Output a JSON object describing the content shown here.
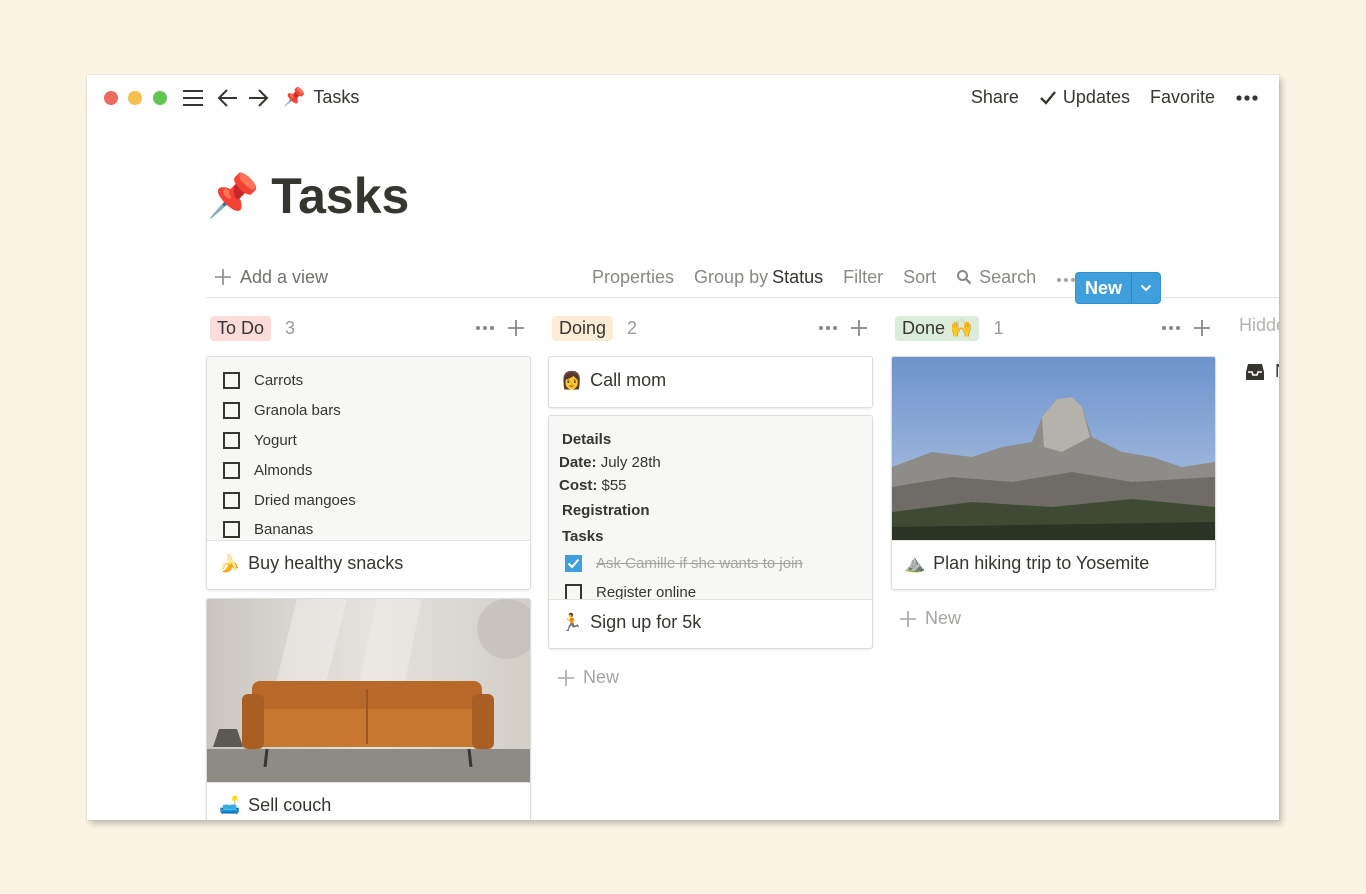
{
  "window": {
    "breadcrumb": {
      "emoji": "📌",
      "title": "Tasks"
    },
    "actions": {
      "share": "Share",
      "updates": "Updates",
      "favorite": "Favorite"
    }
  },
  "page": {
    "emoji": "📌",
    "title": "Tasks"
  },
  "viewbar": {
    "add_view": "Add a view",
    "properties": "Properties",
    "group_by_prefix": "Group by",
    "group_by_value": "Status",
    "filter": "Filter",
    "sort": "Sort",
    "search": "Search",
    "new_button": "New"
  },
  "columns": [
    {
      "name": "To Do",
      "count": "3",
      "color": "#fbdcda"
    },
    {
      "name": "Doing",
      "count": "2",
      "color": "#fbecd5"
    },
    {
      "name": "Done 🙌",
      "count": "1",
      "color": "#dbecdb"
    }
  ],
  "hidden_column": {
    "label": "Hidde"
  },
  "hidden_item": {
    "label": "N"
  },
  "todo_cards": {
    "snacks": {
      "items": [
        "Carrots",
        "Granola bars",
        "Yogurt",
        "Almonds",
        "Dried mangoes",
        "Bananas"
      ],
      "emoji": "🍌",
      "title": "Buy healthy snacks"
    },
    "couch": {
      "emoji": "🛋️",
      "title": "Sell couch"
    }
  },
  "doing_cards": {
    "call": {
      "emoji": "👩",
      "title": "Call mom"
    },
    "run": {
      "details_heading": "Details",
      "date_label": "Date:",
      "date_value": "July 28th",
      "cost_label": "Cost:",
      "cost_value": "$55",
      "registration_heading": "Registration",
      "tasks_heading": "Tasks",
      "task1": "Ask Camille if she wants to join",
      "task2": "Register online",
      "emoji": "🏃",
      "title": "Sign up for 5k"
    }
  },
  "done_cards": {
    "hike": {
      "emoji": "⛰️",
      "title": "Plan hiking trip to Yosemite"
    }
  },
  "add_new_label": "New"
}
